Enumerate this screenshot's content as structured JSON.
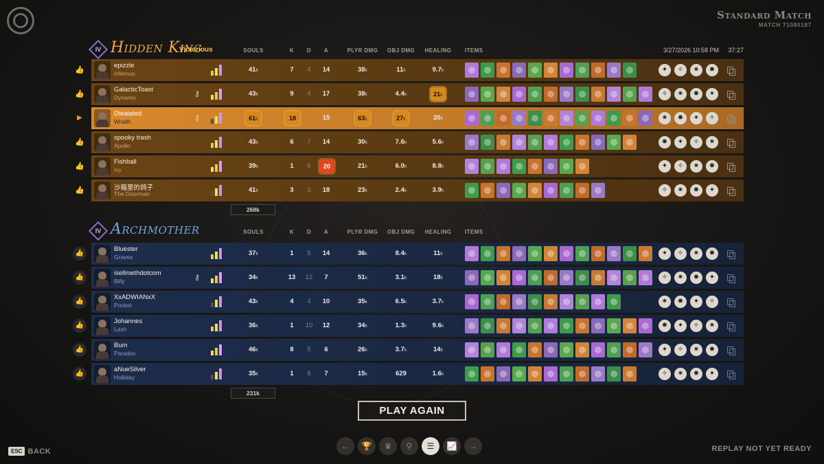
{
  "window": {
    "title": "Standard Match",
    "match_id": "MATCH 71080187"
  },
  "icons": {
    "logo": "game-logo-icon",
    "thumb": "thumbs-up-icon",
    "copy": "copy-icon",
    "key": "keyhole-icon",
    "arrow": "play-arrow-icon"
  },
  "columns": {
    "souls": "SOULS",
    "k": "K",
    "d": "D",
    "a": "A",
    "plyr_dmg": "PLYR DMG",
    "obj_dmg": "OBJ DMG",
    "healing": "HEALING",
    "items": "ITEMS"
  },
  "match": {
    "datetime": "3/27/2026 10:58 PM",
    "duration": "37:27"
  },
  "team1": {
    "rank": "IV",
    "name": "Hidden King",
    "result": "Victorious",
    "accent": "#f0a94a",
    "total_souls": "268k",
    "players": [
      {
        "name": "epizzle",
        "hero": "Infernus",
        "souls": "41",
        "k": "7",
        "d": "4",
        "a": "14",
        "plyr_dmg": "38",
        "obj_dmg": "11",
        "healing": "9.7"
      },
      {
        "name": "GalacticToast",
        "hero": "Dynamo",
        "souls": "43",
        "k": "9",
        "d": "4",
        "a": "17",
        "plyr_dmg": "38",
        "obj_dmg": "4.4",
        "healing": "21"
      },
      {
        "name": "Dlealated",
        "hero": "Wraith",
        "souls": "61",
        "k": "18",
        "d": "4",
        "a": "15",
        "plyr_dmg": "63",
        "obj_dmg": "27",
        "healing": "20"
      },
      {
        "name": "spooky trash",
        "hero": "Apollo",
        "souls": "43",
        "k": "6",
        "d": "7",
        "a": "14",
        "plyr_dmg": "30",
        "obj_dmg": "7.6",
        "healing": "5.6"
      },
      {
        "name": "Fishball",
        "hero": "Ivy",
        "souls": "39",
        "k": "1",
        "d": "6",
        "a": "20",
        "plyr_dmg": "21",
        "obj_dmg": "6.0",
        "healing": "8.8"
      },
      {
        "name": "沙箱里的鸽子",
        "hero": "The Doorman",
        "souls": "41",
        "k": "3",
        "d": "3",
        "a": "18",
        "plyr_dmg": "23",
        "obj_dmg": "2.4",
        "healing": "3.9"
      }
    ]
  },
  "team2": {
    "rank": "IV",
    "name": "Archmother",
    "accent": "#6fa6e6",
    "total_souls": "231k",
    "players": [
      {
        "name": "Bluester",
        "hero": "Graves",
        "souls": "37",
        "k": "1",
        "d": "5",
        "a": "14",
        "plyr_dmg": "36",
        "obj_dmg": "8.4",
        "healing": "11"
      },
      {
        "name": "isellmethdotcom",
        "hero": "Billy",
        "souls": "34",
        "k": "13",
        "d": "12",
        "a": "7",
        "plyr_dmg": "51",
        "obj_dmg": "3.1",
        "healing": "18"
      },
      {
        "name": "XxADWIANxX",
        "hero": "Pocket",
        "souls": "43",
        "k": "4",
        "d": "4",
        "a": "10",
        "plyr_dmg": "35",
        "obj_dmg": "6.5",
        "healing": "3.7"
      },
      {
        "name": "Johannes",
        "hero": "Lash",
        "souls": "36",
        "k": "1",
        "d": "10",
        "a": "12",
        "plyr_dmg": "34",
        "obj_dmg": "1.3",
        "healing": "9.6"
      },
      {
        "name": "Bum",
        "hero": "Paradox",
        "souls": "46",
        "k": "8",
        "d": "5",
        "a": "6",
        "plyr_dmg": "26",
        "obj_dmg": "3.7",
        "healing": "14"
      },
      {
        "name": "aNueSilver",
        "hero": "Holliday",
        "souls": "35",
        "k": "1",
        "d": "8",
        "a": "7",
        "plyr_dmg": "15",
        "obj_dmg": "629",
        "healing": "1.6"
      }
    ]
  },
  "units": {
    "k": "k"
  },
  "buttons": {
    "play_again": "PLAY AGAIN",
    "back_key": "ESC",
    "back": "BACK"
  },
  "status": {
    "replay": "REPLAY NOT YET READY"
  },
  "nav_icons": [
    "arrow-left-icon",
    "trophy-icon",
    "crown-icon",
    "map-pin-icon",
    "scoreboard-icon",
    "graph-icon",
    "arrow-right-icon"
  ]
}
